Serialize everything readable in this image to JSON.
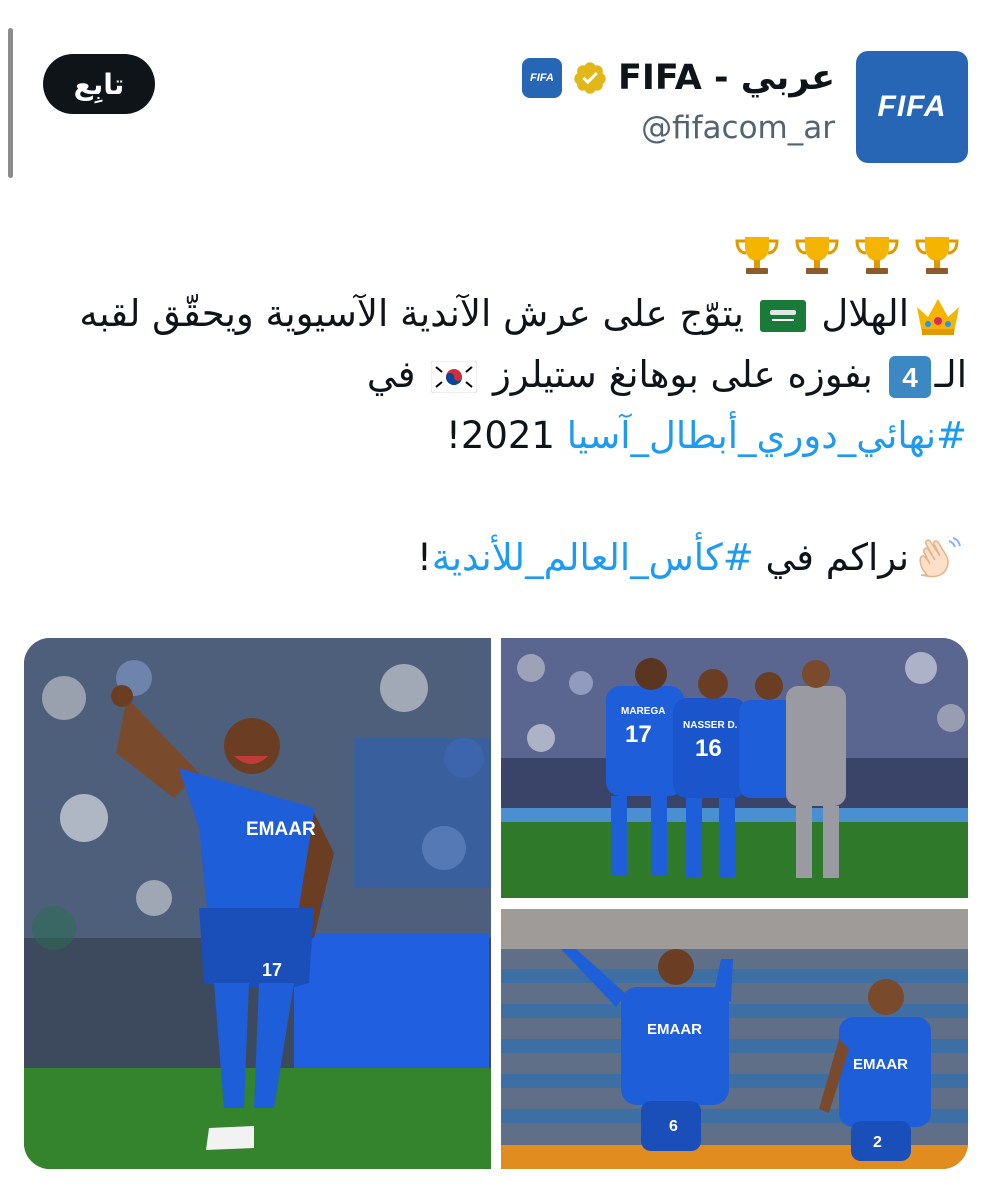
{
  "header": {
    "display_name": "FIFA - عربي",
    "handle": "@fifacom_ar",
    "avatar_text": "FIFA",
    "badge_text": "FIFA",
    "follow_label": "تابِع"
  },
  "tweet": {
    "line1_text": "الهلال",
    "line1_text_b": "يتوّج على عرش الآندية الآسيوية ويحقّق لقبه",
    "line2_text_a": "الـ",
    "line2_num": "4",
    "line2_text_b": "بفوزه على بوهانغ ستيلرز",
    "line2_text_c": "في",
    "line3_hashtag": "#نهائي_دوري_أبطال_آسيا",
    "line3_text": "2021!",
    "line5_text": "نراكم في",
    "line5_hashtag": "#كأس_العالم_للأندية",
    "line5_end": "!"
  },
  "media": {
    "photos": [
      {
        "jersey_text": "EMAAR",
        "number": "17"
      },
      {
        "jersey_a": "MAREGA",
        "number_a": "17",
        "jersey_b": "NASSER D.",
        "number_b": "16"
      },
      {
        "jersey_a": "EMAAR",
        "number_a": "6",
        "jersey_b": "EMAAR",
        "number_b": "2"
      }
    ]
  },
  "colors": {
    "accent": "#1d9bf0",
    "brand": "#2766b5",
    "text": "#0f1419",
    "muted": "#536471"
  }
}
